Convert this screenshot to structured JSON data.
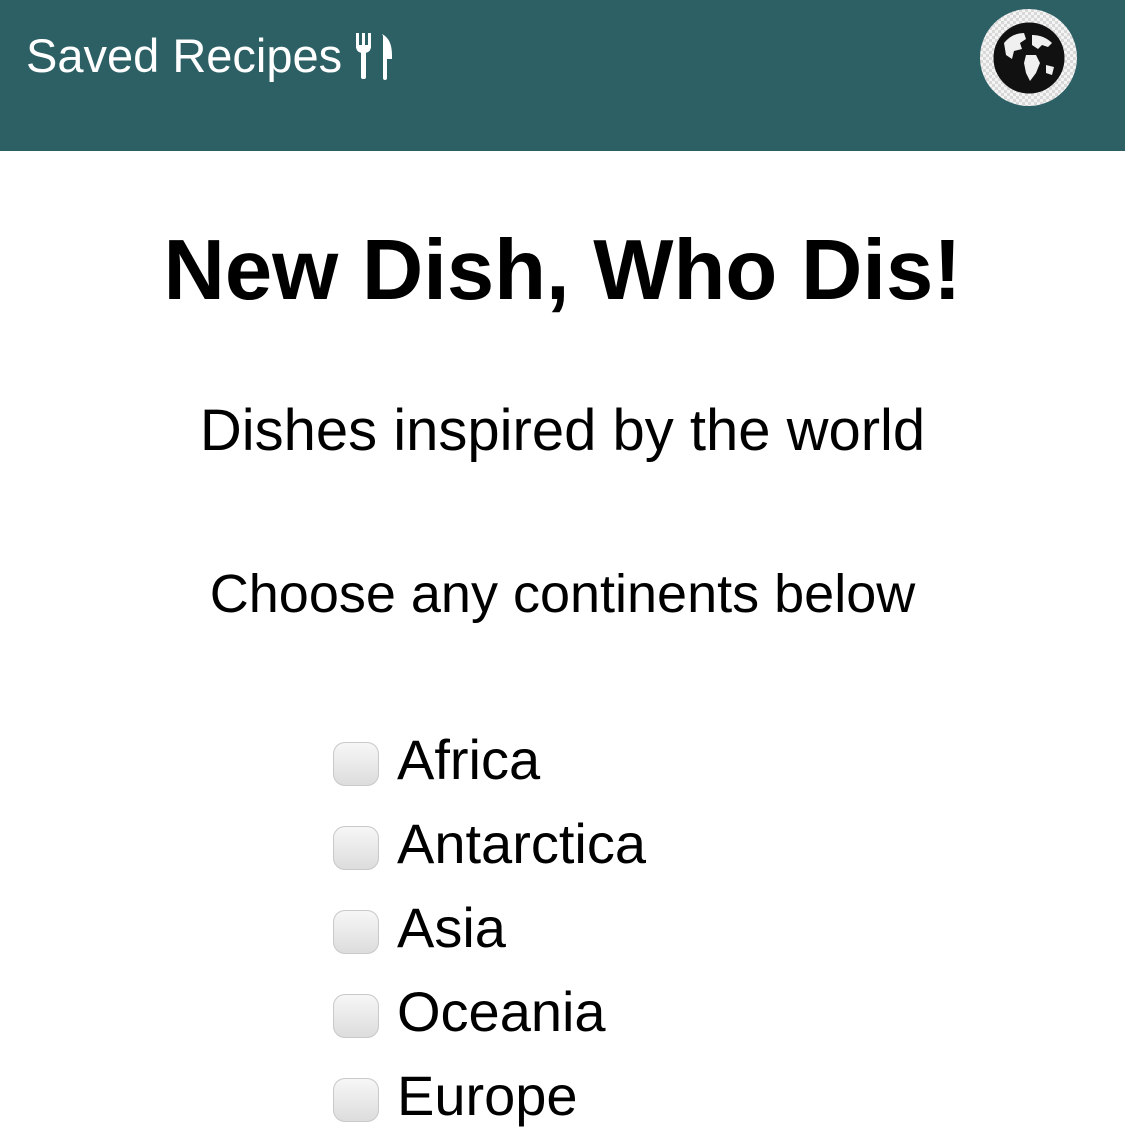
{
  "header": {
    "saved_recipes_label": "Saved Recipes",
    "fork_knife_icon": "fork-knife-icon",
    "globe_icon": "globe-icon",
    "colors": {
      "header_bg": "#2c6065",
      "header_text": "#ffffff"
    }
  },
  "main": {
    "title": "New Dish, Who Dis!",
    "subtitle": "Dishes inspired by the world",
    "prompt": "Choose any continents below"
  },
  "continents": [
    {
      "label": "Africa",
      "checked": false
    },
    {
      "label": "Antarctica",
      "checked": false
    },
    {
      "label": "Asia",
      "checked": false
    },
    {
      "label": "Oceania",
      "checked": false
    },
    {
      "label": "Europe",
      "checked": false
    }
  ]
}
